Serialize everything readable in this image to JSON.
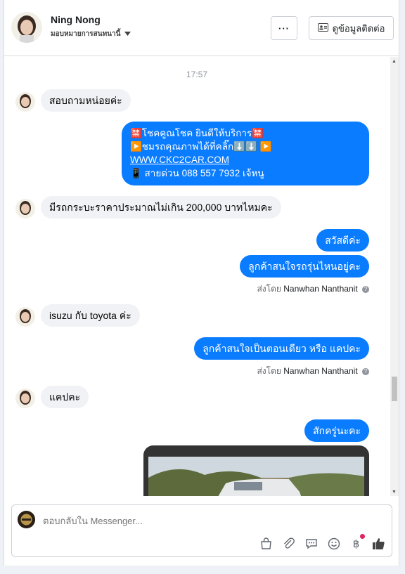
{
  "header": {
    "name": "Ning Nong",
    "subtitle": "มอบหมายการสนทนานี้",
    "more_label": "···",
    "contact_label": "ดูข้อมูลติดต่อ"
  },
  "thread": {
    "timestamp": "17:57",
    "messages": [
      {
        "dir": "in",
        "text": "สอบถามหน่อยค่ะ"
      },
      {
        "dir": "out-multi",
        "lines": [
          "🈲โชคคูณโชค ยินดีให้บริการ🈲",
          "▶️ชมรถคุณภาพได้ที่คลิ๊ก⬇️⬇️        ▶️",
          "WWW.CKC2CAR.COM",
          "📱 สายด่วน 088 557 7932 เจ้หนู"
        ]
      },
      {
        "dir": "in",
        "text": "มีรถกระบะราคาประมาณไม่เกิน 200,000 บาทไหมคะ"
      },
      {
        "dir": "out",
        "text": "สวัสดีค่ะ"
      },
      {
        "dir": "out",
        "text": "ลูกค้าสนใจรถรุ่นไหนอยู่คะ"
      },
      {
        "dir": "in",
        "text": "isuzu กับ toyota ค่ะ"
      },
      {
        "dir": "out",
        "text": "ลูกค้าสนใจเป็นตอนเดียว หรือ แคปคะ"
      },
      {
        "dir": "in",
        "text": "แคปคะ"
      },
      {
        "dir": "out",
        "text": "สักครู่นะคะ"
      }
    ],
    "sent_by_prefix": "ส่งโดย",
    "sent_by_name": "Nanwhan Nanthanit"
  },
  "composer": {
    "placeholder": "ตอบกลับใน Messenger..."
  },
  "icons": [
    "ellipsis-icon",
    "contact-card-icon",
    "chevron-down-icon",
    "bag-icon",
    "paperclip-icon",
    "chat-bubble-icon",
    "emoji-icon",
    "baht-icon",
    "thumbs-up-icon",
    "help-icon"
  ],
  "colors": {
    "accent": "#0a7cff",
    "incoming_bg": "#f0f2f5",
    "notify_dot": "#e0245e"
  }
}
